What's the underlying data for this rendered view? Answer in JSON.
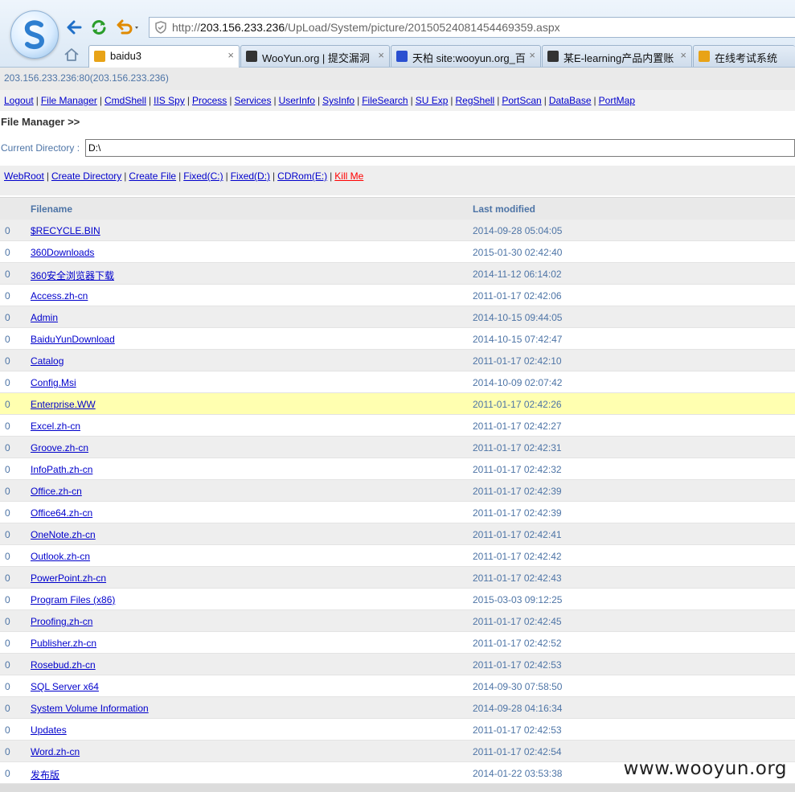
{
  "browser": {
    "url_prefix": "http://",
    "url_host": "203.156.233.236",
    "url_path": "/UpLoad/System/picture/20150524081454469359.aspx",
    "tabs": [
      {
        "label": "baidu3",
        "active": true
      },
      {
        "label": "WooYun.org | 提交漏洞",
        "active": false
      },
      {
        "label": "天柏 site:wooyun.org_百",
        "active": false
      },
      {
        "label": "某E-learning产品内置账",
        "active": false
      },
      {
        "label": "在线考试系统",
        "active": false
      }
    ],
    "close_glyph": "×"
  },
  "host_info": "203.156.233.236:80(203.156.233.236)",
  "menu": [
    "Logout",
    "File Manager",
    "CmdShell",
    "IIS Spy",
    "Process",
    "Services",
    "UserInfo",
    "SysInfo",
    "FileSearch",
    "SU Exp",
    "RegShell",
    "PortScan",
    "DataBase",
    "PortMap"
  ],
  "section_title": "File Manager >>",
  "current_directory": {
    "label": "Current Directory :",
    "value": "D:\\"
  },
  "actions": [
    {
      "label": "WebRoot",
      "danger": false
    },
    {
      "label": "Create Directory",
      "danger": false
    },
    {
      "label": "Create File",
      "danger": false
    },
    {
      "label": "Fixed(C:)",
      "danger": false
    },
    {
      "label": "Fixed(D:)",
      "danger": false
    },
    {
      "label": "CDRom(E:)",
      "danger": false
    },
    {
      "label": "Kill Me",
      "danger": true
    }
  ],
  "table": {
    "headers": {
      "filename": "Filename",
      "last_modified": "Last modified"
    },
    "rows": [
      {
        "col0": "0",
        "name": "$RECYCLE.BIN",
        "modified": "2014-09-28 05:04:05"
      },
      {
        "col0": "0",
        "name": "360Downloads",
        "modified": "2015-01-30 02:42:40"
      },
      {
        "col0": "0",
        "name": "360安全浏览器下载",
        "modified": "2014-11-12 06:14:02"
      },
      {
        "col0": "0",
        "name": "Access.zh-cn",
        "modified": "2011-01-17 02:42:06"
      },
      {
        "col0": "0",
        "name": "Admin",
        "modified": "2014-10-15 09:44:05"
      },
      {
        "col0": "0",
        "name": "BaiduYunDownload",
        "modified": "2014-10-15 07:42:47"
      },
      {
        "col0": "0",
        "name": "Catalog",
        "modified": "2011-01-17 02:42:10"
      },
      {
        "col0": "0",
        "name": "Config.Msi",
        "modified": "2014-10-09 02:07:42"
      },
      {
        "col0": "0",
        "name": "Enterprise.WW",
        "modified": "2011-01-17 02:42:26",
        "highlighted": true
      },
      {
        "col0": "0",
        "name": "Excel.zh-cn",
        "modified": "2011-01-17 02:42:27"
      },
      {
        "col0": "0",
        "name": "Groove.zh-cn",
        "modified": "2011-01-17 02:42:31"
      },
      {
        "col0": "0",
        "name": "InfoPath.zh-cn",
        "modified": "2011-01-17 02:42:32"
      },
      {
        "col0": "0",
        "name": "Office.zh-cn",
        "modified": "2011-01-17 02:42:39"
      },
      {
        "col0": "0",
        "name": "Office64.zh-cn",
        "modified": "2011-01-17 02:42:39"
      },
      {
        "col0": "0",
        "name": "OneNote.zh-cn",
        "modified": "2011-01-17 02:42:41"
      },
      {
        "col0": "0",
        "name": "Outlook.zh-cn",
        "modified": "2011-01-17 02:42:42"
      },
      {
        "col0": "0",
        "name": "PowerPoint.zh-cn",
        "modified": "2011-01-17 02:42:43"
      },
      {
        "col0": "0",
        "name": "Program Files (x86)",
        "modified": "2015-03-03 09:12:25"
      },
      {
        "col0": "0",
        "name": "Proofing.zh-cn",
        "modified": "2011-01-17 02:42:45"
      },
      {
        "col0": "0",
        "name": "Publisher.zh-cn",
        "modified": "2011-01-17 02:42:52"
      },
      {
        "col0": "0",
        "name": "Rosebud.zh-cn",
        "modified": "2011-01-17 02:42:53"
      },
      {
        "col0": "0",
        "name": "SQL Server x64",
        "modified": "2014-09-30 07:58:50"
      },
      {
        "col0": "0",
        "name": "System Volume Information",
        "modified": "2014-09-28 04:16:34"
      },
      {
        "col0": "0",
        "name": "Updates",
        "modified": "2011-01-17 02:42:53"
      },
      {
        "col0": "0",
        "name": "Word.zh-cn",
        "modified": "2011-01-17 02:42:54"
      },
      {
        "col0": "0",
        "name": "发布版",
        "modified": "2014-01-22 03:53:38"
      }
    ]
  },
  "watermark": "www.wooyun.org",
  "colors": {
    "link": "#0000cc",
    "muted_blue": "#4d74a6",
    "danger": "#ff0000",
    "highlight_row": "#ffffb0"
  },
  "icons": [
    "browser-logo-icon",
    "back-arrow-icon",
    "refresh-icon",
    "undo-icon",
    "shield-icon",
    "home-icon",
    "favicon-icon",
    "tab-close-icon"
  ]
}
